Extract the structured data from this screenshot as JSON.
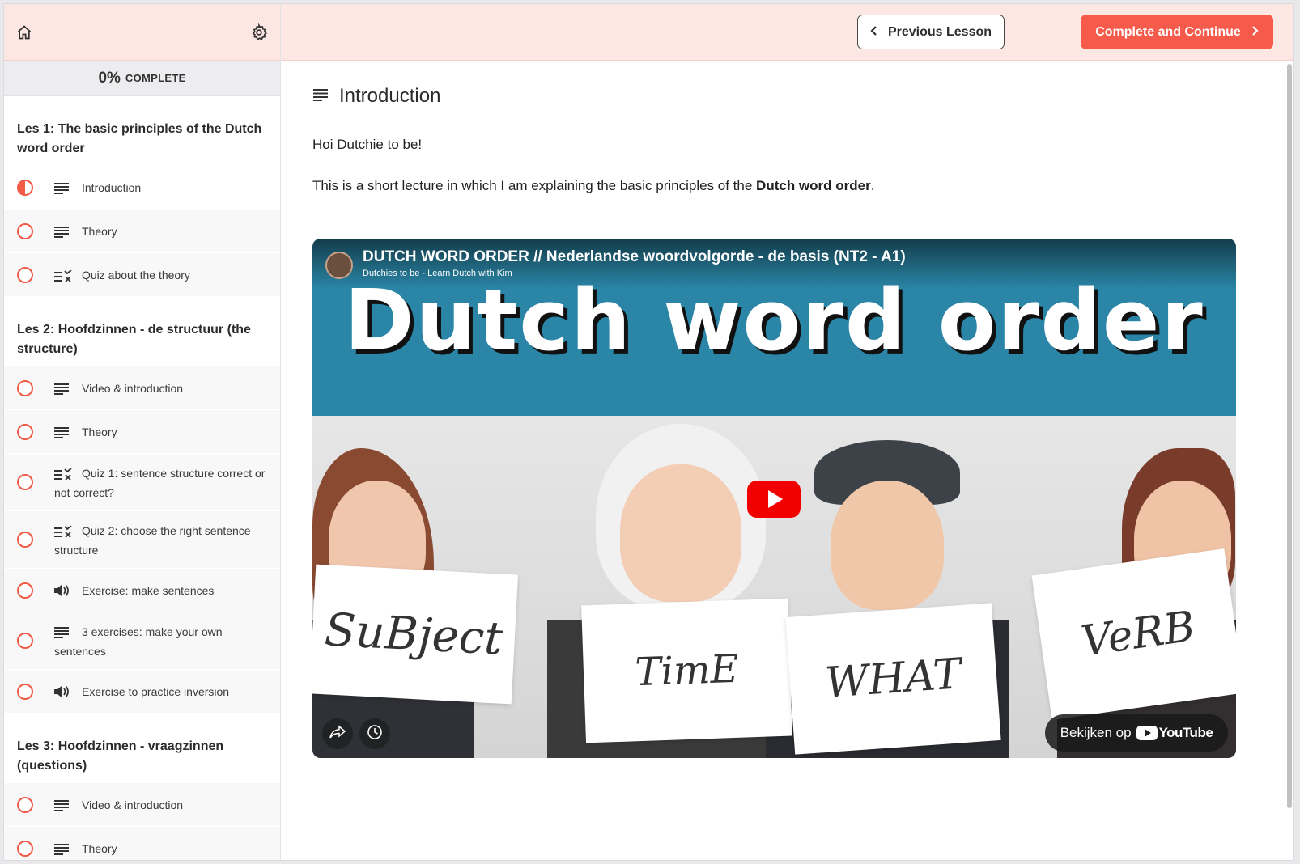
{
  "sidebar": {
    "home_icon": "home-icon",
    "settings_icon": "gear-icon",
    "progress": {
      "percent": "0%",
      "label": "COMPLETE"
    },
    "sections": [
      {
        "title": "Les 1: The basic principles of the Dutch word order",
        "items": [
          {
            "label": "Introduction",
            "type": "text",
            "status": "in-progress"
          },
          {
            "label": "Theory",
            "type": "text",
            "status": "not-started"
          },
          {
            "label": "Quiz about the theory",
            "type": "quiz",
            "status": "not-started"
          }
        ]
      },
      {
        "title": "Les 2: Hoofdzinnen - de structuur (the structure)",
        "items": [
          {
            "label": "Video & introduction",
            "type": "text",
            "status": "not-started"
          },
          {
            "label": "Theory",
            "type": "text",
            "status": "not-started"
          },
          {
            "label": "Quiz 1: sentence structure correct or not correct?",
            "type": "quiz",
            "status": "not-started"
          },
          {
            "label": "Quiz 2: choose the right sentence structure",
            "type": "quiz",
            "status": "not-started"
          },
          {
            "label": "Exercise: make sentences",
            "type": "audio",
            "status": "not-started"
          },
          {
            "label": "3 exercises: make your own sentences",
            "type": "text",
            "status": "not-started"
          },
          {
            "label": "Exercise to practice inversion",
            "type": "audio",
            "status": "not-started"
          }
        ]
      },
      {
        "title": "Les 3: Hoofdzinnen - vraagzinnen (questions)",
        "items": [
          {
            "label": "Video & introduction",
            "type": "text",
            "status": "not-started"
          },
          {
            "label": "Theory",
            "type": "text",
            "status": "not-started"
          }
        ]
      }
    ]
  },
  "topbar": {
    "prev_label": "Previous Lesson",
    "next_label": "Complete and Continue"
  },
  "main": {
    "title": "Introduction",
    "greeting": "Hoi Dutchie to be!",
    "body_prefix": "This is a short lecture in which I am explaining the basic principles of the ",
    "body_bold": "Dutch word order",
    "body_suffix": "."
  },
  "video": {
    "title": "DUTCH WORD ORDER // Nederlandse woordvolgorde - de basis (NT2 - A1)",
    "channel": "Dutchies to be - Learn Dutch with Kim",
    "thumbnail_heading": "Dutch word order",
    "signs": [
      "SuBject",
      "TimE",
      "WHAT",
      "VeRB"
    ],
    "watch_on": "Bekijken op",
    "watch_brand": "YouTube"
  },
  "colors": {
    "accent": "#f55a4a",
    "topbar_bg": "#fde7e3",
    "banner_blue": "#2a85a6"
  }
}
